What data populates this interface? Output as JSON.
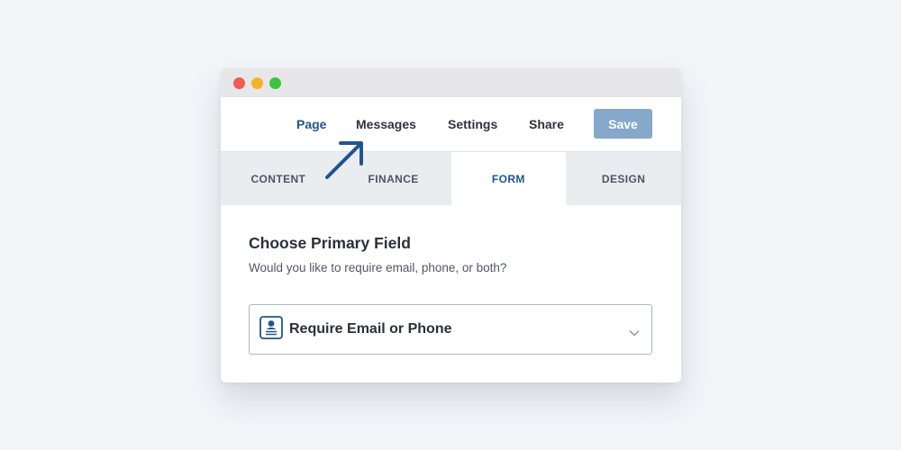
{
  "window": {
    "controls": [
      {
        "name": "close",
        "color": "#f15b52"
      },
      {
        "name": "minimize",
        "color": "#f6b22a"
      },
      {
        "name": "maximize",
        "color": "#3cc43f"
      }
    ]
  },
  "topnav": {
    "items": [
      {
        "label": "Page",
        "active": true
      },
      {
        "label": "Messages",
        "active": false
      },
      {
        "label": "Settings",
        "active": false
      },
      {
        "label": "Share",
        "active": false
      }
    ],
    "save_label": "Save"
  },
  "tabs": [
    {
      "label": "CONTENT",
      "active": false
    },
    {
      "label": "FINANCE",
      "active": false
    },
    {
      "label": "FORM",
      "active": true
    },
    {
      "label": "DESIGN",
      "active": false
    }
  ],
  "form": {
    "heading": "Choose Primary Field",
    "subtext": "Would you like to require email, phone, or both?",
    "select": {
      "icon": "contact-card-icon",
      "value": "Require Email or Phone"
    }
  },
  "annotation": {
    "icon": "arrow-up-right-icon",
    "color": "#1f5591"
  },
  "colors": {
    "accent": "#1f5591",
    "save_button": "#86a8cb",
    "tab_bar": "#eaedf0",
    "background": "#f4f5f9"
  }
}
